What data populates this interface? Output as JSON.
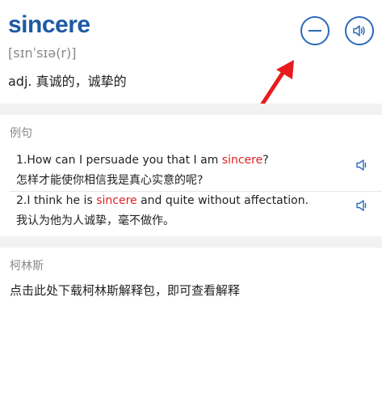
{
  "entry": {
    "word": "sincere",
    "phonetic": "[sɪnˈsɪə(r)]",
    "definition": "adj. 真诚的，诚挚的"
  },
  "buttons": {
    "collapse_icon": "minus-circle-icon",
    "pronounce_icon": "speaker-circle-icon"
  },
  "annotation": {
    "arrow_color": "#e81c1c"
  },
  "examples_section": {
    "title": "例句",
    "items": [
      {
        "number": "1.",
        "en_before": "How can I persuade you that I am ",
        "keyword": "sincere",
        "en_after": "?",
        "zh": "怎样才能使你相信我是真心实意的呢?"
      },
      {
        "number": "2.",
        "en_before": "I think he is ",
        "keyword": "sincere",
        "en_after": " and quite without affectation.",
        "zh": "我认为他为人诚挚，毫不做作。"
      }
    ]
  },
  "collins_section": {
    "title": "柯林斯",
    "message": "点击此处下载柯林斯解释包，即可查看解释"
  },
  "colors": {
    "word": "#1d5aa6",
    "accent": "#2b6ab8",
    "highlight": "#e02020",
    "band": "#f2f2f2"
  }
}
